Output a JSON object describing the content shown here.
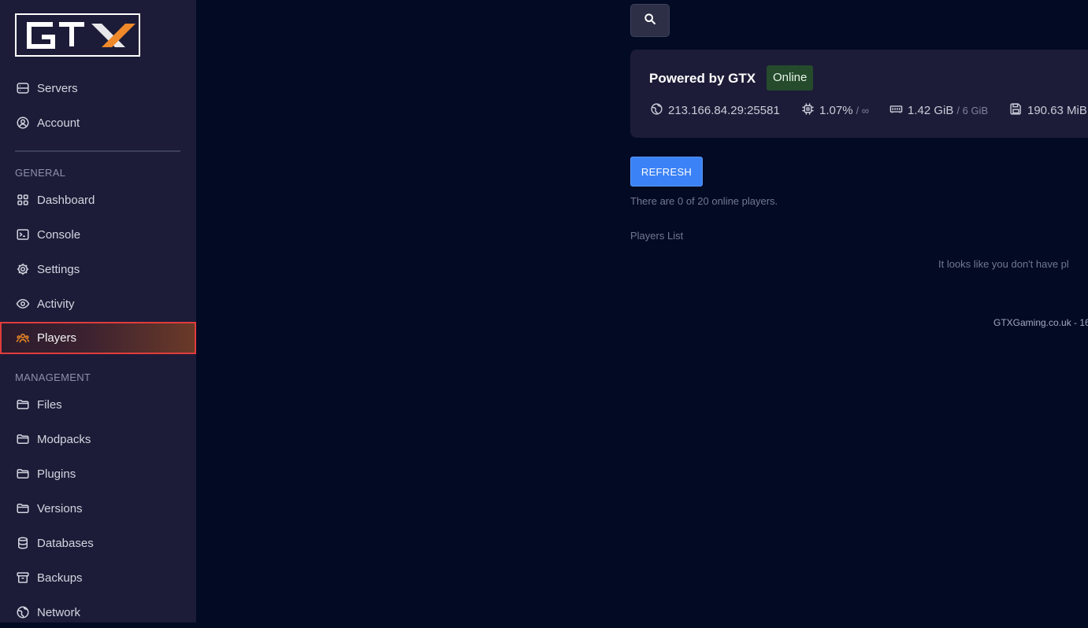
{
  "brand": {
    "logo_text": "GTX"
  },
  "sidebar": {
    "top_items": [
      {
        "label": "Servers",
        "icon": "server-icon"
      },
      {
        "label": "Account",
        "icon": "user-circle-icon"
      }
    ],
    "general_label": "GENERAL",
    "general_items": [
      {
        "label": "Dashboard",
        "icon": "grid-icon"
      },
      {
        "label": "Console",
        "icon": "terminal-icon"
      },
      {
        "label": "Settings",
        "icon": "gear-icon"
      },
      {
        "label": "Activity",
        "icon": "eye-icon"
      },
      {
        "label": "Players",
        "icon": "users-icon",
        "active": true
      }
    ],
    "management_label": "MANAGEMENT",
    "management_items": [
      {
        "label": "Files",
        "icon": "folder-icon"
      },
      {
        "label": "Modpacks",
        "icon": "folder-icon"
      },
      {
        "label": "Plugins",
        "icon": "folder-icon"
      },
      {
        "label": "Versions",
        "icon": "folder-icon"
      },
      {
        "label": "Databases",
        "icon": "database-icon"
      },
      {
        "label": "Backups",
        "icon": "archive-icon"
      },
      {
        "label": "Network",
        "icon": "globe-icon"
      }
    ]
  },
  "server": {
    "name": "Powered by GTX",
    "status": "Online",
    "address": "213.166.84.29:25581",
    "cpu": "1.07%",
    "cpu_limit": "/ ∞",
    "memory": "1.42 GiB",
    "memory_limit": "/ 6 GiB",
    "disk": "190.63 MiB"
  },
  "players": {
    "refresh_label": "REFRESH",
    "count_text": "There are 0 of 20 online players.",
    "list_label": "Players List",
    "empty_text": "It looks like you don't have pl"
  },
  "footer": {
    "text": "GTXGaming.co.uk - 16"
  },
  "colors": {
    "accent": "#3b82f6",
    "active_highlight": "#e03c3c",
    "active_icon": "#f08a24",
    "status_online": "#254a2c"
  }
}
